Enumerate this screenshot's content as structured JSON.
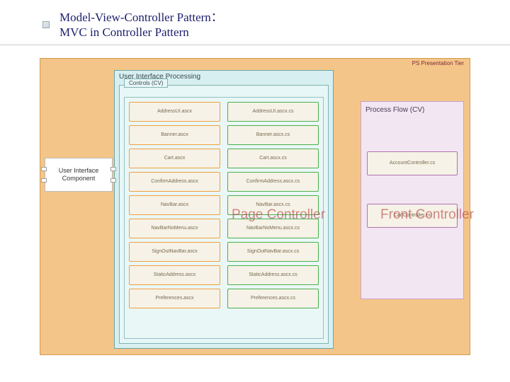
{
  "title": {
    "line1": "Model-View-Controller Pattern：",
    "line2": "MVC in Controller Pattern"
  },
  "tier_label": "PS Presentation Tier",
  "uip_title": "User Interface Processing",
  "controls_tab": "Controls (CV)",
  "pf_title": "Process Flow (CV)",
  "uic_label": "User Interface Component",
  "overlay_page_controller": "Page Controller",
  "overlay_front_controller": "Front Controller",
  "left_files": [
    "AddressUI.ascx",
    "Banner.ascx",
    "Cart.ascx",
    "ConfirmAddress.ascx",
    "NavBar.ascx",
    "NavBarNoMenu.ascx",
    "SignOutNavBar.ascx",
    "StaticAddress.ascx",
    "Preferences.ascx"
  ],
  "right_files": [
    "AddressUI.ascx.cs",
    "Banner.ascx.cs",
    "Cart.ascx.cs",
    "ConfirmAddress.ascx.cs",
    "NavBar.ascx.cs",
    "NavBarNoMenu.ascx.cs",
    "SignOutNavBar.ascx.cs",
    "StaticAddress.ascx.cs",
    "Preferences.ascx.cs"
  ],
  "pf_files": [
    "AccountController.cs",
    "CartController.cs"
  ]
}
